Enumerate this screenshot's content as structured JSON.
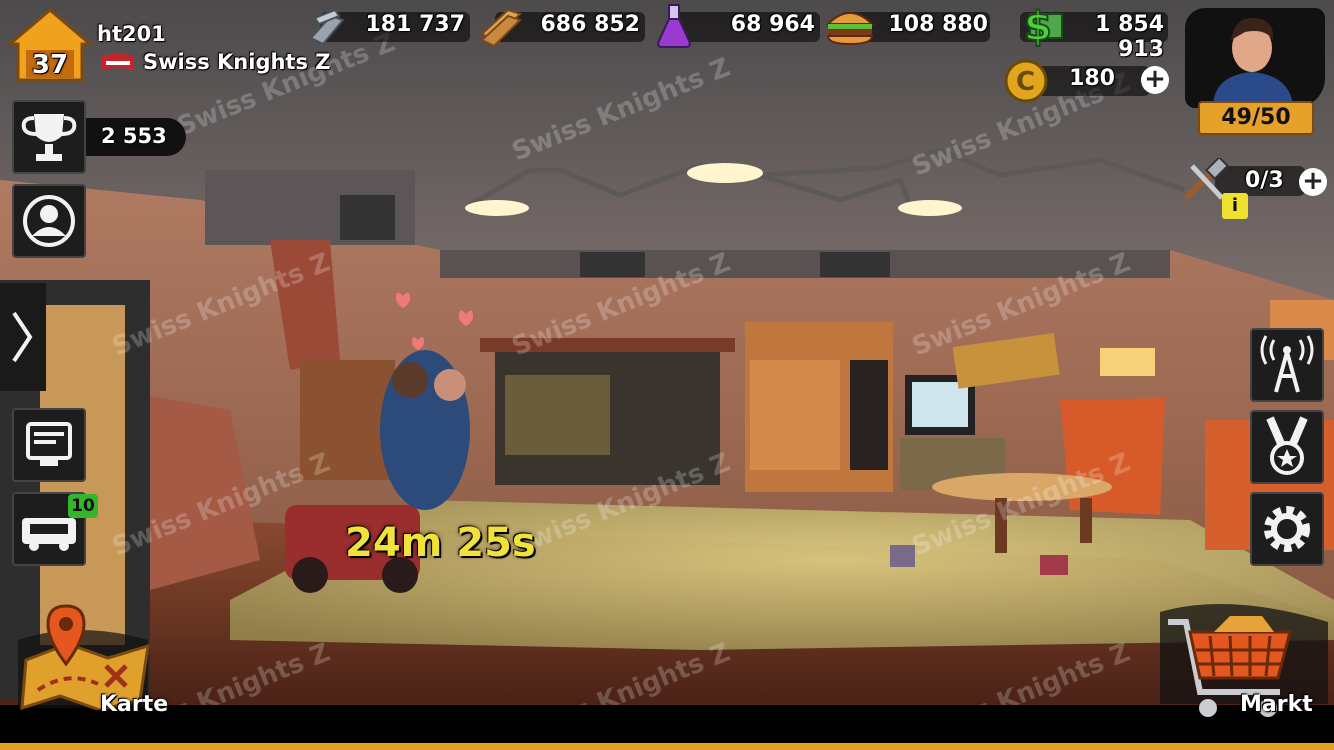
{
  "player": {
    "level": "37",
    "name": "ht201",
    "team": "Swiss Knights Z"
  },
  "resources": [
    {
      "icon": "steel-icon",
      "value": "181 737"
    },
    {
      "icon": "wood-icon",
      "value": "686 852"
    },
    {
      "icon": "potion-icon",
      "value": "68 964"
    },
    {
      "icon": "food-icon",
      "value": "108 880"
    },
    {
      "icon": "cash-icon",
      "value": "1 854 913"
    }
  ],
  "coins": {
    "value": "180"
  },
  "energy": {
    "value": "49/50"
  },
  "builders": {
    "value": "0/3"
  },
  "trophies": {
    "value": "2 553"
  },
  "timer": {
    "value": "24m 25s"
  },
  "garage": {
    "badge": "10"
  },
  "nav": {
    "map_label": "Karte",
    "market_label": "Markt"
  },
  "watermark": "Swiss Knights Z",
  "colors": {
    "timer_yellow": "#f1e23a",
    "badge_green": "#35b52b",
    "energy_orange": "#e6a12b",
    "coin_gold": "#e2a51e",
    "bottom_orange": "#e2a01c"
  }
}
